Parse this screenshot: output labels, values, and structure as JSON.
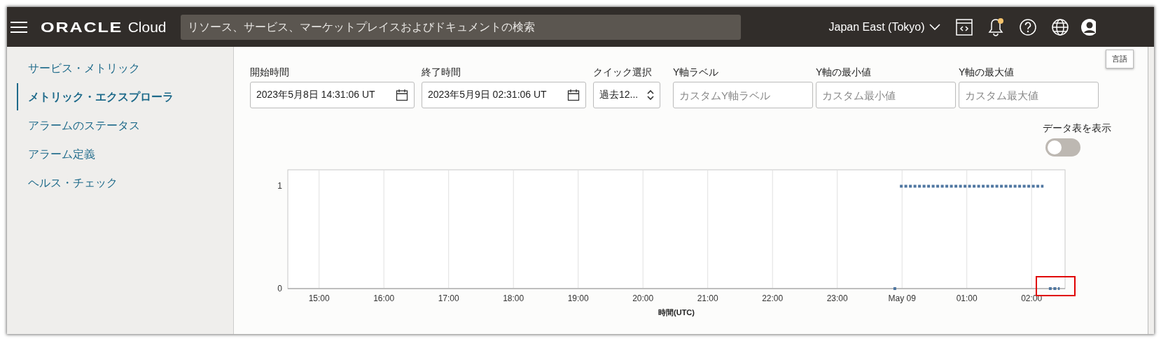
{
  "header": {
    "logo": {
      "brand": "ORACLE",
      "product": "Cloud"
    },
    "search": {
      "placeholder": "リソース、サービス、マーケットプレイスおよびドキュメントの検索"
    },
    "region": "Japan East (Tokyo)",
    "notification_dot": true,
    "tooltip": "言語"
  },
  "sidebar": {
    "items": [
      {
        "label": "サービス・メトリック",
        "selected": false
      },
      {
        "label": "メトリック・エクスプローラ",
        "selected": true
      },
      {
        "label": "アラームのステータス",
        "selected": false
      },
      {
        "label": "アラーム定義",
        "selected": false
      },
      {
        "label": "ヘルス・チェック",
        "selected": false
      }
    ]
  },
  "filters": [
    {
      "kind": "date",
      "label": "開始時間",
      "value": "2023年5月8日 14:31:06 UT"
    },
    {
      "kind": "date",
      "label": "終了時間",
      "value": "2023年5月9日 02:31:06 UT"
    },
    {
      "kind": "select",
      "label": "クイック選択",
      "value": "過去12..."
    },
    {
      "kind": "text",
      "label": "Y軸ラベル",
      "placeholder": "カスタムY軸ラベル"
    },
    {
      "kind": "text",
      "label": "Y軸の最小値",
      "placeholder": "カスタム最小値"
    },
    {
      "kind": "text",
      "label": "Y軸の最大値",
      "placeholder": "カスタム最大値"
    }
  ],
  "data_table": {
    "label": "データ表を表示",
    "on": false
  },
  "chart": {
    "chart_data": {
      "type": "line",
      "xlabel": "時間(UTC)",
      "x": [
        "2023-05-08T23:52",
        "2023-05-08T23:56",
        "2023-05-08T23:58",
        "2023-05-09T02:11",
        "2023-05-09T02:16",
        "2023-05-09T02:26"
      ],
      "series": [
        {
          "color": "#4f76a0",
          "line_style": "dotted",
          "values": [
            0,
            0,
            null,
            null,
            0,
            0
          ]
        },
        {
          "color": "#4f76a0",
          "line_style": "dotted",
          "values": [
            null,
            null,
            1,
            1,
            null,
            null
          ]
        }
      ],
      "xlim": [
        "2023-05-08T14:31",
        "2023-05-09T02:31"
      ],
      "ylim": [
        0,
        1.16
      ],
      "grid": true,
      "xticks": [
        {
          "value": "2023-05-08T15:00",
          "label": "15:00"
        },
        {
          "value": "2023-05-08T16:00",
          "label": "16:00"
        },
        {
          "value": "2023-05-08T17:00",
          "label": "17:00"
        },
        {
          "value": "2023-05-08T18:00",
          "label": "18:00"
        },
        {
          "value": "2023-05-08T19:00",
          "label": "19:00"
        },
        {
          "value": "2023-05-08T20:00",
          "label": "20:00"
        },
        {
          "value": "2023-05-08T21:00",
          "label": "21:00"
        },
        {
          "value": "2023-05-08T22:00",
          "label": "22:00"
        },
        {
          "value": "2023-05-08T23:00",
          "label": "23:00"
        },
        {
          "value": "2023-05-09T00:00",
          "label": "May 09"
        },
        {
          "value": "2023-05-09T01:00",
          "label": "01:00"
        },
        {
          "value": "2023-05-09T02:00",
          "label": "02:00"
        }
      ],
      "yticks": [
        0,
        1
      ]
    },
    "highlight_box": true
  }
}
